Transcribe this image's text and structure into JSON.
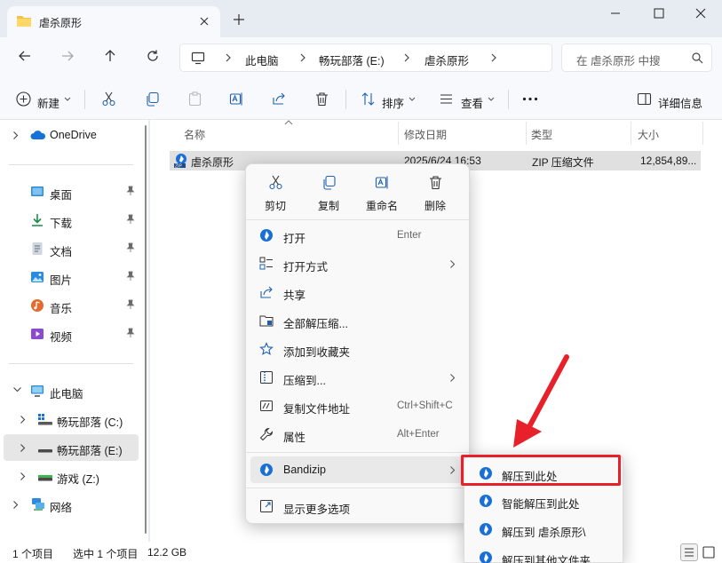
{
  "colors": {
    "accent": "#0067c0",
    "bandizip": "#1a6fd6",
    "highlight_red": "#e8202a"
  },
  "tab": {
    "title": "虐杀原形"
  },
  "address": {
    "crumbs": [
      "此电脑",
      "畅玩部落 (E:)",
      "虐杀原形"
    ],
    "search_placeholder": "在 虐杀原形 中搜"
  },
  "toolbar": {
    "new_label": "新建",
    "sort_label": "排序",
    "view_label": "查看",
    "details_label": "详细信息"
  },
  "nav": {
    "onedrive": "OneDrive",
    "quick": [
      {
        "label": "桌面",
        "icon": "desktop-icon"
      },
      {
        "label": "下载",
        "icon": "download-icon"
      },
      {
        "label": "文档",
        "icon": "document-icon"
      },
      {
        "label": "图片",
        "icon": "pictures-icon"
      },
      {
        "label": "音乐",
        "icon": "music-icon"
      },
      {
        "label": "视频",
        "icon": "video-icon"
      }
    ],
    "this_pc": "此电脑",
    "drives": [
      "畅玩部落 (C:)",
      "畅玩部落 (E:)",
      "游戏 (Z:)"
    ],
    "network": "网络"
  },
  "columns": [
    "名称",
    "修改日期",
    "类型",
    "大小"
  ],
  "file": {
    "name": "虐杀原形",
    "date": "2025/6/24 16:53",
    "type": "ZIP 压缩文件",
    "size": "12,854,89..."
  },
  "status": {
    "count": "1 个项目",
    "selected": "选中 1 个项目",
    "size": "12.2 GB"
  },
  "context_menu": {
    "quick_actions": [
      "剪切",
      "复制",
      "重命名",
      "删除"
    ],
    "items": [
      {
        "label": "打开",
        "shortcut": "Enter"
      },
      {
        "label": "打开方式",
        "shortcut": ""
      },
      {
        "label": "共享",
        "shortcut": ""
      },
      {
        "label": "全部解压缩...",
        "shortcut": ""
      },
      {
        "label": "添加到收藏夹",
        "shortcut": ""
      },
      {
        "label": "压缩到...",
        "shortcut": ""
      },
      {
        "label": "复制文件地址",
        "shortcut": "Ctrl+Shift+C"
      },
      {
        "label": "属性",
        "shortcut": "Alt+Enter"
      },
      {
        "label": "Bandizip",
        "shortcut": ""
      },
      {
        "label": "显示更多选项",
        "shortcut": ""
      }
    ]
  },
  "submenu": [
    "解压到此处",
    "智能解压到此处",
    "解压到 虐杀原形\\",
    "解压到其他文件夹..."
  ]
}
